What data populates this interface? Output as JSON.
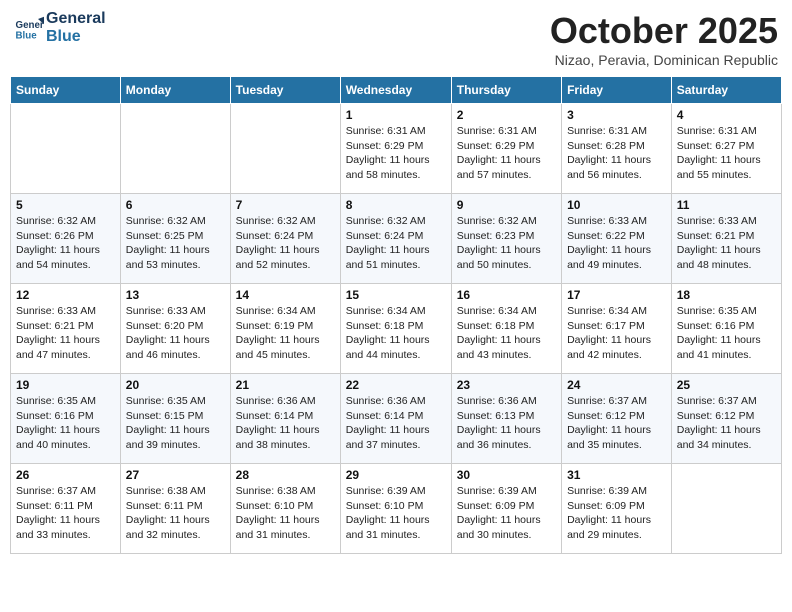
{
  "header": {
    "logo_line1": "General",
    "logo_line2": "Blue",
    "month": "October 2025",
    "location": "Nizao, Peravia, Dominican Republic"
  },
  "days_of_week": [
    "Sunday",
    "Monday",
    "Tuesday",
    "Wednesday",
    "Thursday",
    "Friday",
    "Saturday"
  ],
  "weeks": [
    [
      {
        "day": "",
        "info": ""
      },
      {
        "day": "",
        "info": ""
      },
      {
        "day": "",
        "info": ""
      },
      {
        "day": "1",
        "info": "Sunrise: 6:31 AM\nSunset: 6:29 PM\nDaylight: 11 hours and 58 minutes."
      },
      {
        "day": "2",
        "info": "Sunrise: 6:31 AM\nSunset: 6:29 PM\nDaylight: 11 hours and 57 minutes."
      },
      {
        "day": "3",
        "info": "Sunrise: 6:31 AM\nSunset: 6:28 PM\nDaylight: 11 hours and 56 minutes."
      },
      {
        "day": "4",
        "info": "Sunrise: 6:31 AM\nSunset: 6:27 PM\nDaylight: 11 hours and 55 minutes."
      }
    ],
    [
      {
        "day": "5",
        "info": "Sunrise: 6:32 AM\nSunset: 6:26 PM\nDaylight: 11 hours and 54 minutes."
      },
      {
        "day": "6",
        "info": "Sunrise: 6:32 AM\nSunset: 6:25 PM\nDaylight: 11 hours and 53 minutes."
      },
      {
        "day": "7",
        "info": "Sunrise: 6:32 AM\nSunset: 6:24 PM\nDaylight: 11 hours and 52 minutes."
      },
      {
        "day": "8",
        "info": "Sunrise: 6:32 AM\nSunset: 6:24 PM\nDaylight: 11 hours and 51 minutes."
      },
      {
        "day": "9",
        "info": "Sunrise: 6:32 AM\nSunset: 6:23 PM\nDaylight: 11 hours and 50 minutes."
      },
      {
        "day": "10",
        "info": "Sunrise: 6:33 AM\nSunset: 6:22 PM\nDaylight: 11 hours and 49 minutes."
      },
      {
        "day": "11",
        "info": "Sunrise: 6:33 AM\nSunset: 6:21 PM\nDaylight: 11 hours and 48 minutes."
      }
    ],
    [
      {
        "day": "12",
        "info": "Sunrise: 6:33 AM\nSunset: 6:21 PM\nDaylight: 11 hours and 47 minutes."
      },
      {
        "day": "13",
        "info": "Sunrise: 6:33 AM\nSunset: 6:20 PM\nDaylight: 11 hours and 46 minutes."
      },
      {
        "day": "14",
        "info": "Sunrise: 6:34 AM\nSunset: 6:19 PM\nDaylight: 11 hours and 45 minutes."
      },
      {
        "day": "15",
        "info": "Sunrise: 6:34 AM\nSunset: 6:18 PM\nDaylight: 11 hours and 44 minutes."
      },
      {
        "day": "16",
        "info": "Sunrise: 6:34 AM\nSunset: 6:18 PM\nDaylight: 11 hours and 43 minutes."
      },
      {
        "day": "17",
        "info": "Sunrise: 6:34 AM\nSunset: 6:17 PM\nDaylight: 11 hours and 42 minutes."
      },
      {
        "day": "18",
        "info": "Sunrise: 6:35 AM\nSunset: 6:16 PM\nDaylight: 11 hours and 41 minutes."
      }
    ],
    [
      {
        "day": "19",
        "info": "Sunrise: 6:35 AM\nSunset: 6:16 PM\nDaylight: 11 hours and 40 minutes."
      },
      {
        "day": "20",
        "info": "Sunrise: 6:35 AM\nSunset: 6:15 PM\nDaylight: 11 hours and 39 minutes."
      },
      {
        "day": "21",
        "info": "Sunrise: 6:36 AM\nSunset: 6:14 PM\nDaylight: 11 hours and 38 minutes."
      },
      {
        "day": "22",
        "info": "Sunrise: 6:36 AM\nSunset: 6:14 PM\nDaylight: 11 hours and 37 minutes."
      },
      {
        "day": "23",
        "info": "Sunrise: 6:36 AM\nSunset: 6:13 PM\nDaylight: 11 hours and 36 minutes."
      },
      {
        "day": "24",
        "info": "Sunrise: 6:37 AM\nSunset: 6:12 PM\nDaylight: 11 hours and 35 minutes."
      },
      {
        "day": "25",
        "info": "Sunrise: 6:37 AM\nSunset: 6:12 PM\nDaylight: 11 hours and 34 minutes."
      }
    ],
    [
      {
        "day": "26",
        "info": "Sunrise: 6:37 AM\nSunset: 6:11 PM\nDaylight: 11 hours and 33 minutes."
      },
      {
        "day": "27",
        "info": "Sunrise: 6:38 AM\nSunset: 6:11 PM\nDaylight: 11 hours and 32 minutes."
      },
      {
        "day": "28",
        "info": "Sunrise: 6:38 AM\nSunset: 6:10 PM\nDaylight: 11 hours and 31 minutes."
      },
      {
        "day": "29",
        "info": "Sunrise: 6:39 AM\nSunset: 6:10 PM\nDaylight: 11 hours and 31 minutes."
      },
      {
        "day": "30",
        "info": "Sunrise: 6:39 AM\nSunset: 6:09 PM\nDaylight: 11 hours and 30 minutes."
      },
      {
        "day": "31",
        "info": "Sunrise: 6:39 AM\nSunset: 6:09 PM\nDaylight: 11 hours and 29 minutes."
      },
      {
        "day": "",
        "info": ""
      }
    ]
  ]
}
